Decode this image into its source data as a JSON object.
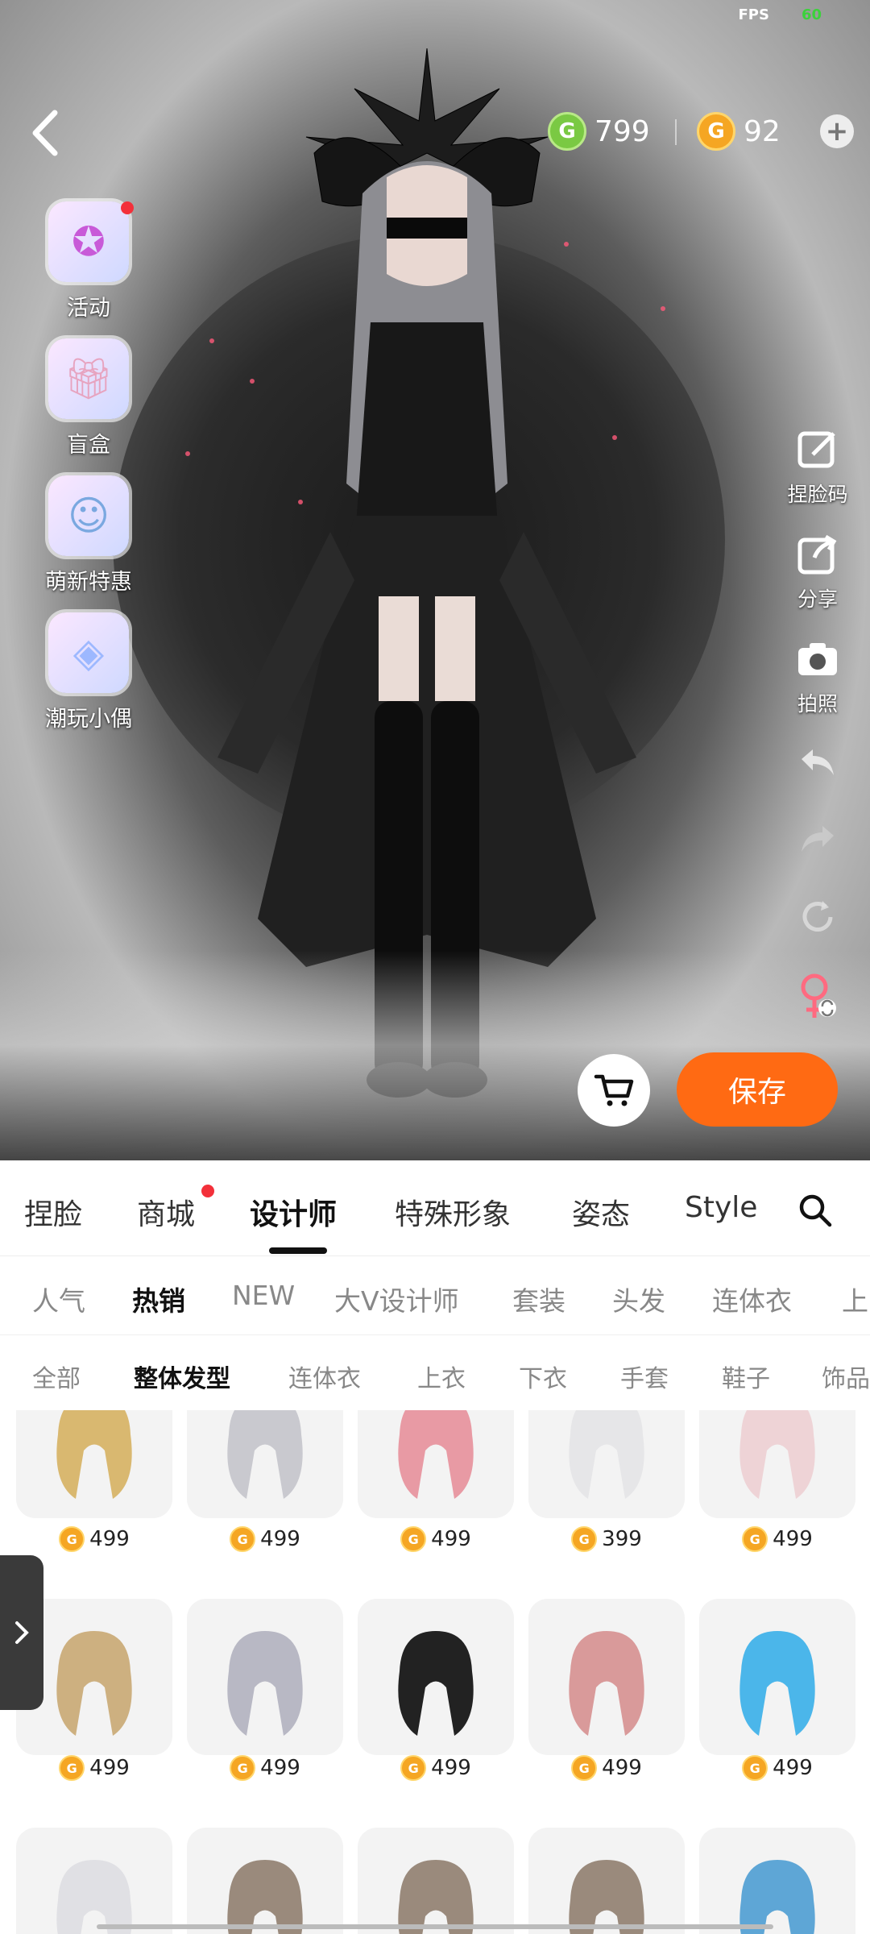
{
  "status": {
    "fps_label": "FPS",
    "fps_value": "60"
  },
  "header": {
    "currency": [
      {
        "name": "green-coin",
        "value": "799",
        "symbol": "G"
      },
      {
        "name": "gold-coin",
        "value": "92",
        "symbol": "G"
      }
    ]
  },
  "left_menu": [
    {
      "label": "活动",
      "icon": "star-icon",
      "dot": true
    },
    {
      "label": "盲盒",
      "icon": "gift-box-icon",
      "dot": false
    },
    {
      "label": "萌新特惠",
      "icon": "character-icon",
      "dot": false
    },
    {
      "label": "潮玩小偶",
      "icon": "cube-box-icon",
      "dot": false
    }
  ],
  "right_menu": [
    {
      "label": "捏脸码",
      "icon": "edit-icon"
    },
    {
      "label": "分享",
      "icon": "share-icon"
    },
    {
      "label": "拍照",
      "icon": "camera-icon"
    }
  ],
  "actions": {
    "save_label": "保存"
  },
  "tabs": [
    {
      "label": "捏脸",
      "active": false,
      "dot": false
    },
    {
      "label": "商城",
      "active": false,
      "dot": true
    },
    {
      "label": "设计师",
      "active": true,
      "dot": false
    },
    {
      "label": "特殊形象",
      "active": false,
      "dot": false
    },
    {
      "label": "姿态",
      "active": false,
      "dot": false
    },
    {
      "label": "Style",
      "active": false,
      "dot": false
    }
  ],
  "subtabs": [
    {
      "label": "人气",
      "active": false
    },
    {
      "label": "热销",
      "active": true
    },
    {
      "label": "NEW",
      "active": false
    },
    {
      "label": "大V设计师",
      "active": false
    },
    {
      "label": "套装",
      "active": false
    },
    {
      "label": "头发",
      "active": false
    },
    {
      "label": "连体衣",
      "active": false
    },
    {
      "label": "上",
      "active": false
    }
  ],
  "categories": [
    {
      "label": "全部",
      "active": false
    },
    {
      "label": "整体发型",
      "active": true
    },
    {
      "label": "连体衣",
      "active": false
    },
    {
      "label": "上衣",
      "active": false
    },
    {
      "label": "下衣",
      "active": false
    },
    {
      "label": "手套",
      "active": false
    },
    {
      "label": "鞋子",
      "active": false
    },
    {
      "label": "饰品",
      "active": false
    }
  ],
  "items": [
    {
      "price": "499",
      "hair": "#d9b870"
    },
    {
      "price": "499",
      "hair": "#c9c9cf"
    },
    {
      "price": "499",
      "hair": "#e89aa4"
    },
    {
      "price": "399",
      "hair": "#e6e6e8"
    },
    {
      "price": "499",
      "hair": "#eed3d6"
    },
    {
      "price": "499",
      "hair": "#cdb080"
    },
    {
      "price": "499",
      "hair": "#b8b8c4"
    },
    {
      "price": "499",
      "hair": "#222222"
    },
    {
      "price": "499",
      "hair": "#d99a9a"
    },
    {
      "price": "499",
      "hair": "#4bb6ea"
    },
    {
      "hair": "#e0e0e4"
    },
    {
      "hair": "#9a8a7c"
    },
    {
      "hair": "#9a8a7c"
    },
    {
      "hair": "#9a8a7c"
    },
    {
      "hair": "#5ea6d6"
    }
  ],
  "colors": {
    "accent": "#ff6a13",
    "badge": "#f3303a",
    "active_tab": "#111111",
    "inactive_tab": "#888888"
  }
}
